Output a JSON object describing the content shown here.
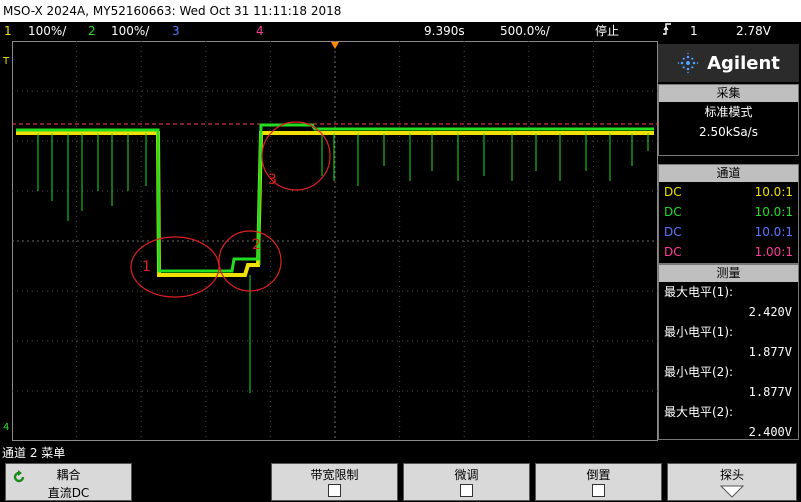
{
  "title": "MSO-X 2024A, MY52160663: Wed Oct 31 11:11:18 2018",
  "status": {
    "ch1_num": "1",
    "ch1_scale": "100%/",
    "ch2_num": "2",
    "ch2_scale": "100%/",
    "ch3_num": "3",
    "ch4_num": "4",
    "time_delay": "9.390s",
    "time_scale": "500.0%/",
    "run_state": "停止",
    "trig_icon": "trigger-edge-icon",
    "trig_channel": "1",
    "trig_level": "2.78V"
  },
  "colors": {
    "ch1": "#f0e000",
    "ch2": "#22dd22",
    "ch3": "#5a78ff",
    "ch4": "#ff3b9a",
    "annot": "#e02020",
    "trigger": "#ff8a00"
  },
  "brand": {
    "name": "Agilent"
  },
  "acquire": {
    "header": "采集",
    "mode": "标准模式",
    "rate": "2.50kSa/s"
  },
  "channels": {
    "header": "通道",
    "rows": [
      {
        "coupling": "DC",
        "probe": "10.0:1"
      },
      {
        "coupling": "DC",
        "probe": "10.0:1"
      },
      {
        "coupling": "DC",
        "probe": "10.0:1"
      },
      {
        "coupling": "DC",
        "probe": "1.00:1"
      }
    ]
  },
  "measure": {
    "header": "测量",
    "rows": [
      {
        "label": "最大电平(1):",
        "value": "2.420V"
      },
      {
        "label": "最小电平(1):",
        "value": "1.877V"
      },
      {
        "label": "最小电平(2):",
        "value": "1.877V"
      },
      {
        "label": "最大电平(2):",
        "value": "2.400V"
      }
    ]
  },
  "annotations": {
    "a1": "1",
    "a2": "2",
    "a3": "3"
  },
  "menu_title": "通道 2 菜单",
  "softkeys": {
    "coupling_top": "耦合",
    "coupling_bottom": "直流DC",
    "bw_limit": "带宽限制",
    "fine": "微调",
    "invert": "倒置",
    "probe": "探头"
  },
  "ground_marker": "T",
  "ground_marker_low": "4"
}
